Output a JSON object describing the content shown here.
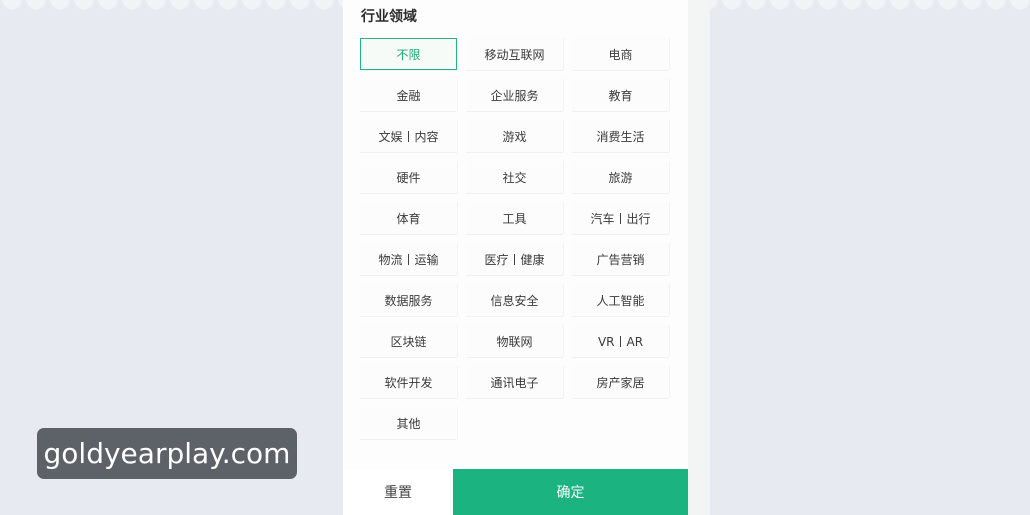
{
  "section": {
    "title": "行业领域"
  },
  "options": [
    {
      "label": "不限",
      "selected": true
    },
    {
      "label": "移动互联网",
      "selected": false
    },
    {
      "label": "电商",
      "selected": false
    },
    {
      "label": "金融",
      "selected": false
    },
    {
      "label": "企业服务",
      "selected": false
    },
    {
      "label": "教育",
      "selected": false
    },
    {
      "label": "文娱丨内容",
      "selected": false
    },
    {
      "label": "游戏",
      "selected": false
    },
    {
      "label": "消费生活",
      "selected": false
    },
    {
      "label": "硬件",
      "selected": false
    },
    {
      "label": "社交",
      "selected": false
    },
    {
      "label": "旅游",
      "selected": false
    },
    {
      "label": "体育",
      "selected": false
    },
    {
      "label": "工具",
      "selected": false
    },
    {
      "label": "汽车丨出行",
      "selected": false
    },
    {
      "label": "物流丨运输",
      "selected": false
    },
    {
      "label": "医疗丨健康",
      "selected": false
    },
    {
      "label": "广告营销",
      "selected": false
    },
    {
      "label": "数据服务",
      "selected": false
    },
    {
      "label": "信息安全",
      "selected": false
    },
    {
      "label": "人工智能",
      "selected": false
    },
    {
      "label": "区块链",
      "selected": false
    },
    {
      "label": "物联网",
      "selected": false
    },
    {
      "label": "VR丨AR",
      "selected": false
    },
    {
      "label": "软件开发",
      "selected": false
    },
    {
      "label": "通讯电子",
      "selected": false
    },
    {
      "label": "房产家居",
      "selected": false
    },
    {
      "label": "其他",
      "selected": false
    }
  ],
  "footer": {
    "reset_label": "重置",
    "confirm_label": "确定"
  },
  "watermark": {
    "text": "goldyearplay.com"
  },
  "colors": {
    "accent": "#1bb380",
    "selected_border": "#29b286",
    "background": "#e8eaf1"
  }
}
